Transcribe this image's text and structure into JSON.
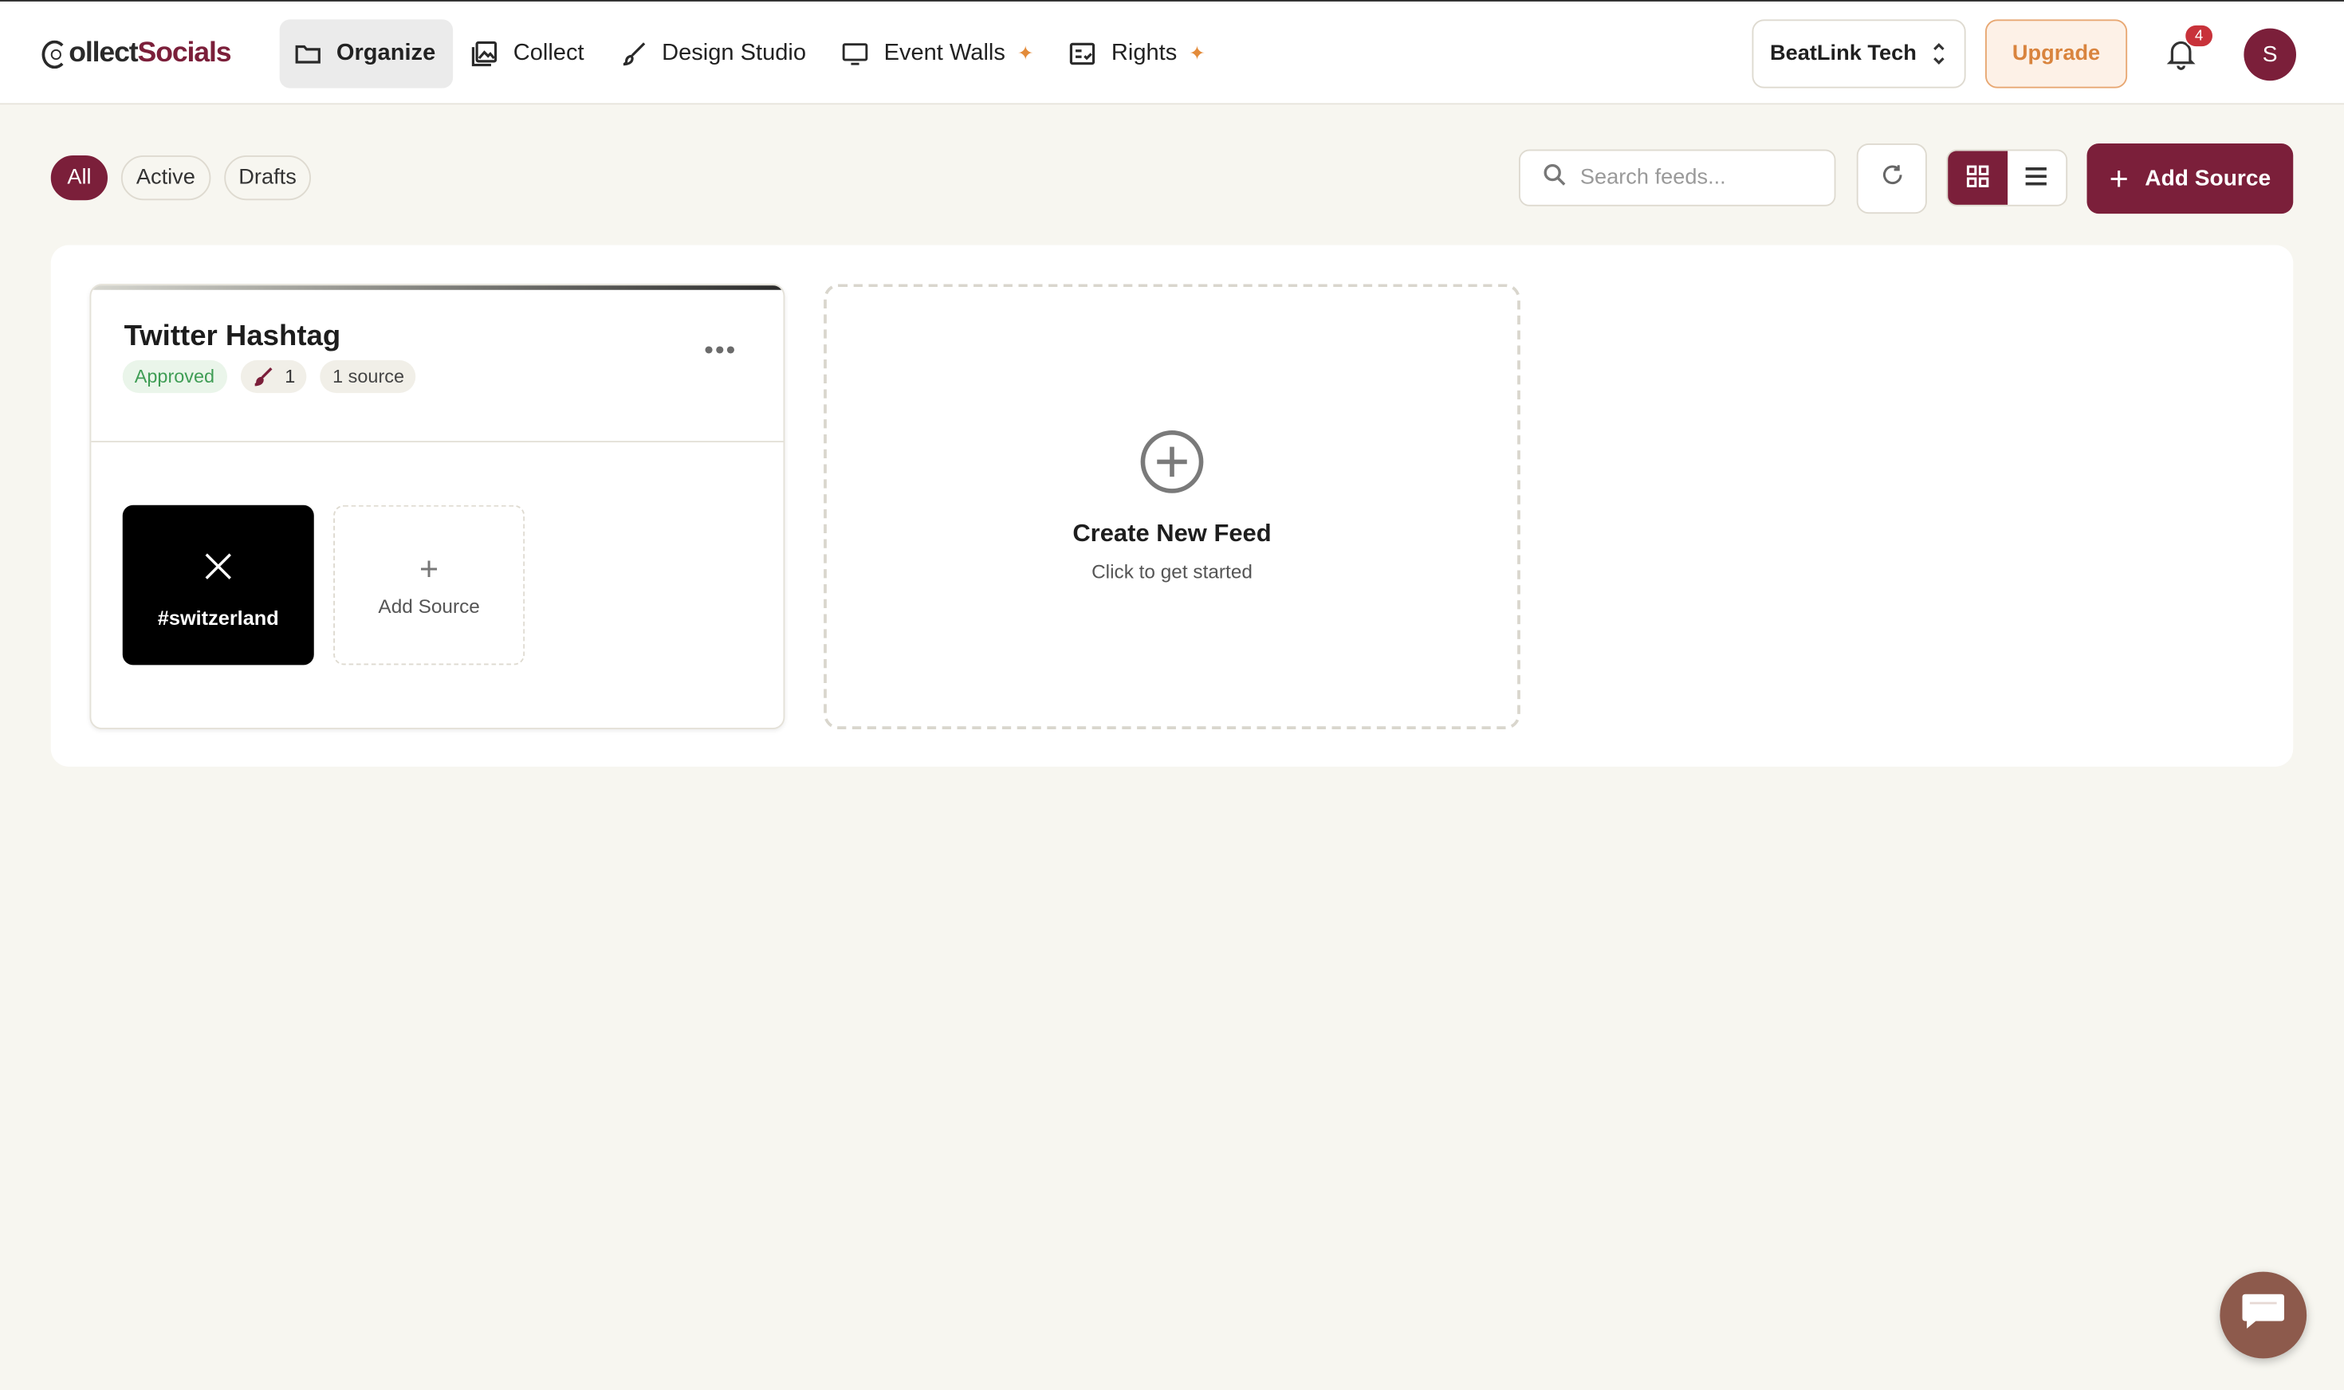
{
  "brand": {
    "part1": "ollect",
    "part2": "Socials",
    "accent": "#7b1f3a"
  },
  "nav": [
    {
      "label": "Organize",
      "icon": "folder-icon",
      "active": true
    },
    {
      "label": "Collect",
      "icon": "images-icon"
    },
    {
      "label": "Design Studio",
      "icon": "brush-icon"
    },
    {
      "label": "Event Walls",
      "icon": "monitor-icon",
      "sparkle": true
    },
    {
      "label": "Rights",
      "icon": "checklist-icon",
      "sparkle": true
    }
  ],
  "header": {
    "workspace": "BeatLink Tech",
    "upgrade_label": "Upgrade",
    "notification_count": "4",
    "avatar_initial": "S"
  },
  "filters": [
    "All",
    "Active",
    "Drafts"
  ],
  "toolbar": {
    "search_placeholder": "Search feeds...",
    "add_source_label": "Add Source"
  },
  "feed": {
    "title": "Twitter Hashtag",
    "status": "Approved",
    "design_count": "1",
    "sources_label": "1 source",
    "source_tag": "#switzerland",
    "add_source_tile_label": "Add Source"
  },
  "create_card": {
    "title": "Create New Feed",
    "subtitle": "Click to get started"
  }
}
